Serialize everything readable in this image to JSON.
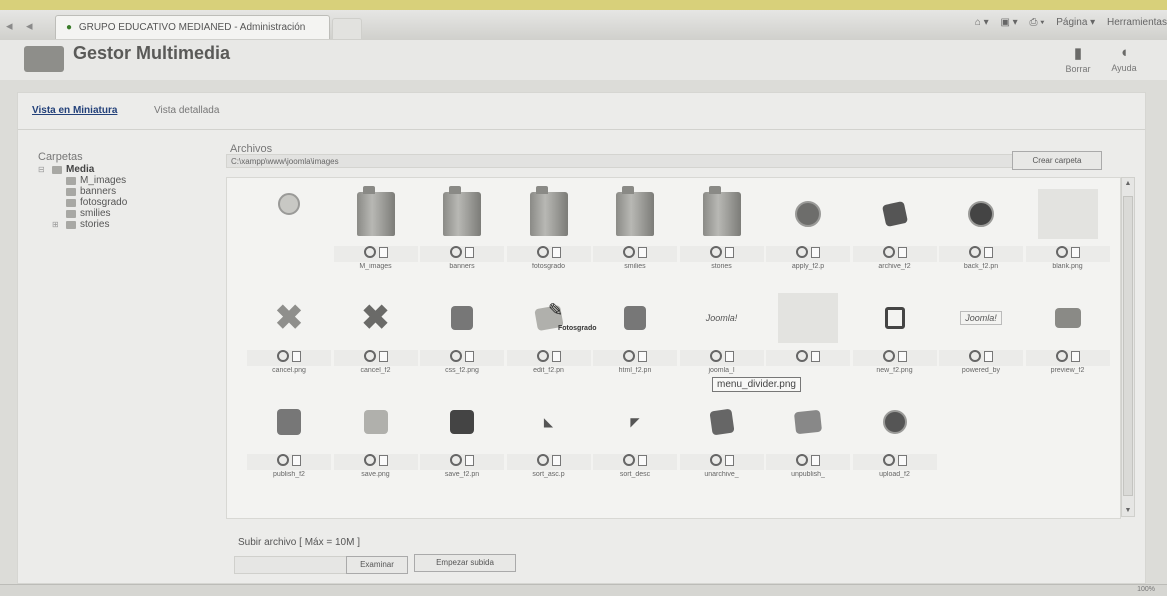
{
  "browser": {
    "nav_back": "◂",
    "nav_fwd": "◂",
    "tab_title": "GRUPO EDUCATIVO MEDIANED - Administración",
    "toolbar": [
      "Página ▾",
      "Herramientas"
    ]
  },
  "header": {
    "title": "Gestor Multimedia",
    "buttons": [
      {
        "label": "Borrar",
        "icon": "trash-icon"
      },
      {
        "label": "Ayuda",
        "icon": "help-icon"
      }
    ]
  },
  "view_tabs": [
    {
      "label": "Vista en Miniatura",
      "active": true
    },
    {
      "label": "Vista detallada",
      "active": false
    }
  ],
  "folders": {
    "heading": "Carpetas",
    "root": "Media",
    "children": [
      "M_images",
      "banners",
      "fotosgrado",
      "smilies"
    ],
    "collapsed": [
      "stories"
    ]
  },
  "files": {
    "label": "Archivos",
    "path": "C:\\xampp\\www\\joomla\\images",
    "create_folder": "Crear carpeta",
    "items": [
      {
        "name": "",
        "icon": "up-arrow-circle-icon"
      },
      {
        "name": "M_images",
        "icon": "folder-icon"
      },
      {
        "name": "banners",
        "icon": "folder-icon"
      },
      {
        "name": "fotosgrado",
        "icon": "folder-icon"
      },
      {
        "name": "smilies",
        "icon": "folder-icon"
      },
      {
        "name": "stories",
        "icon": "folder-icon"
      },
      {
        "name": "apply_f2.p",
        "icon": "apply-icon"
      },
      {
        "name": "archive_f2",
        "icon": "archive-icon"
      },
      {
        "name": "back_f2.pn",
        "icon": "back-icon"
      },
      {
        "name": "blank.png",
        "icon": "blank-icon"
      },
      {
        "name": "cancel.png",
        "icon": "cancel-light-icon"
      },
      {
        "name": "cancel_f2",
        "icon": "cancel-icon"
      },
      {
        "name": "css_f2.png",
        "icon": "css-icon"
      },
      {
        "name": "edit_f2.pn",
        "icon": "edit-icon"
      },
      {
        "name": "html_f2.pn",
        "icon": "html-icon"
      },
      {
        "name": "joomla_l",
        "icon": "joomla-logo-icon"
      },
      {
        "name": "",
        "icon": "blank-icon"
      },
      {
        "name": "new_f2.png",
        "icon": "new-icon"
      },
      {
        "name": "powered_by",
        "icon": "powered-by-icon"
      },
      {
        "name": "preview_f2",
        "icon": "preview-icon"
      },
      {
        "name": "publish_f2",
        "icon": "publish-icon"
      },
      {
        "name": "save.png",
        "icon": "save-light-icon"
      },
      {
        "name": "save_f2.pn",
        "icon": "save-icon"
      },
      {
        "name": "sort_asc.p",
        "icon": "sort-asc-icon"
      },
      {
        "name": "sort_desc",
        "icon": "sort-desc-icon"
      },
      {
        "name": "unarchive_",
        "icon": "unarchive-icon"
      },
      {
        "name": "unpublish_",
        "icon": "unpublish-icon"
      },
      {
        "name": "upload_f2",
        "icon": "upload-icon"
      }
    ],
    "joomla_text": "Joomla!",
    "powered_text": "Joomla!",
    "tooltip": "menu_divider.png",
    "drag_label": "Fotosgrado"
  },
  "upload": {
    "label": "Subir archivo [ Máx = 10M ]",
    "browse": "Examinar",
    "start": "Empezar subida"
  },
  "status": {
    "left": "",
    "right": "",
    "zoom": "100%"
  }
}
